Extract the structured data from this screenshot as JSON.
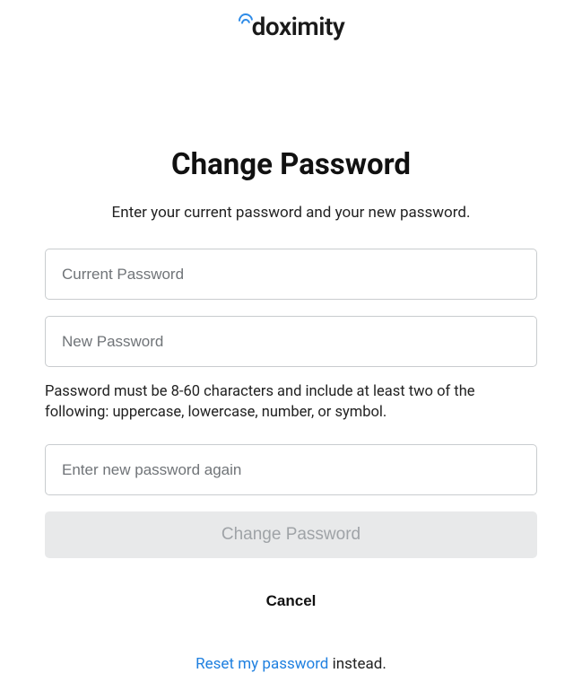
{
  "logo": {
    "text": "doximity"
  },
  "heading": "Change Password",
  "subtitle": "Enter your current password and your new password.",
  "fields": {
    "current": {
      "placeholder": "Current Password",
      "value": ""
    },
    "new": {
      "placeholder": "New Password",
      "value": ""
    },
    "confirm": {
      "placeholder": "Enter new password again",
      "value": ""
    }
  },
  "hint": "Password must be 8-60 characters and include at least two of the following: uppercase, lowercase, number, or symbol.",
  "buttons": {
    "submit": "Change Password",
    "cancel": "Cancel"
  },
  "footer": {
    "link": "Reset my password",
    "suffix": " instead."
  }
}
